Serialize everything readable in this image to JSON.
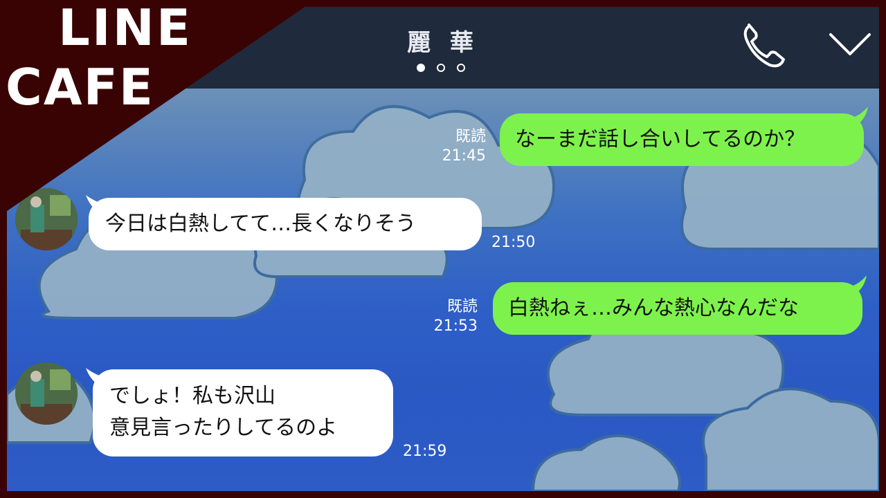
{
  "brand": {
    "line": "LINE",
    "cafe": "CAFE"
  },
  "header": {
    "title": "麗 華",
    "page_count": 3,
    "active_page": 1
  },
  "messages": [
    {
      "dir": "out",
      "text": "なーまだ話し合いしてるのか？",
      "read": "既読",
      "time": "21:45"
    },
    {
      "dir": "in",
      "text": "今日は白熱してて…長くなりそう",
      "time": "21:50"
    },
    {
      "dir": "out",
      "text": "白熱ねぇ…みんな熱心なんだな",
      "read": "既読",
      "time": "21:53"
    },
    {
      "dir": "in",
      "line1": "でしょ！私も沢山",
      "line2": "意見言ったりしてるのよ",
      "time": "21:59"
    }
  ],
  "icons": {
    "call": "phone-icon",
    "collapse": "chevron-down-icon"
  },
  "colors": {
    "header_bg": "#1f2a3c",
    "outgoing_bubble": "#7ef24c",
    "incoming_bubble": "#ffffff",
    "brand_bg": "#3a0303"
  }
}
